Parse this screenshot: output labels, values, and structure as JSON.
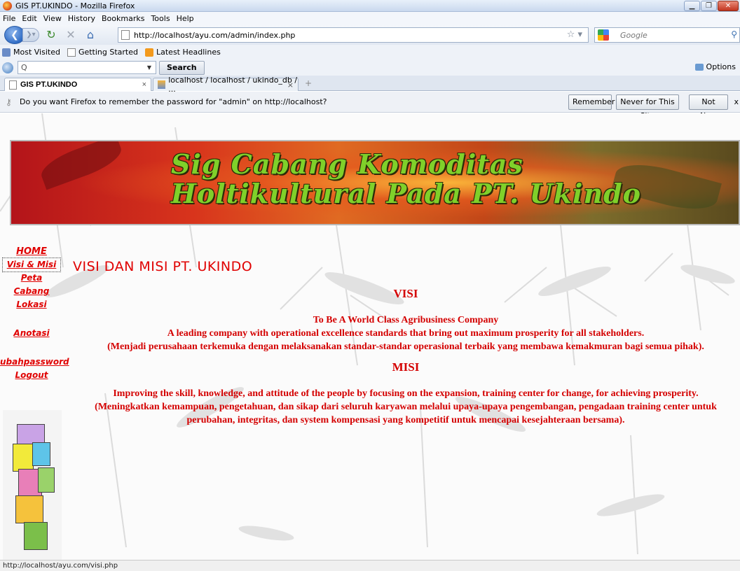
{
  "window": {
    "title": "GIS PT.UKINDO - Mozilla Firefox"
  },
  "menu": [
    "File",
    "Edit",
    "View",
    "History",
    "Bookmarks",
    "Tools",
    "Help"
  ],
  "nav": {
    "url": "http://localhost/ayu.com/admin/index.php",
    "search_engine": "Google"
  },
  "bookmarks": [
    "Most Visited",
    "Getting Started",
    "Latest Headlines"
  ],
  "search_toolbar": {
    "input_value": "Q",
    "button_label": "Search",
    "options_label": "Options"
  },
  "tabs": [
    {
      "label": "GIS PT.UKINDO",
      "close": "×"
    },
    {
      "label": "localhost / localhost / ukindo_db / ...",
      "close": "×"
    }
  ],
  "notification": {
    "message": "Do you want Firefox to remember the password for \"admin\" on http://localhost?",
    "remember": "Remember",
    "never": "Never for This Site",
    "not_now": "Not Now",
    "close": "x"
  },
  "banner": {
    "line1": "Sig Cabang Komoditas",
    "line2": "Holtikultural Pada PT. Ukindo"
  },
  "sidebar": {
    "links": [
      "HOME",
      "Visi & Misi",
      "Peta",
      "Cabang",
      "Lokasi",
      "Anotasi",
      "ubahpassword",
      "Logout"
    ]
  },
  "content": {
    "heading": "VISI DAN MISI PT. UKINDO",
    "visi_title": "VISI",
    "visi_line1": "To Be A World Class Agribusiness Company",
    "visi_line2": "A leading company with operational excellence standards that bring out maximum prosperity for all stakeholders.",
    "visi_line3": "(Menjadi perusahaan terkemuka dengan melaksanakan standar-standar operasional terbaik yang membawa kemakmuran bagi semua pihak).",
    "misi_title": "MISI",
    "misi_line1": "Improving the skill, knowledge, and attitude of the people by focusing on the expansion, training center for change, for achieving prosperity.",
    "misi_line2": "(Meningkatkan kemampuan, pengetahuan, dan sikap dari seluruh karyawan melalui upaya-upaya pengembangan, pengadaan training center untuk perubahan, integritas, dan system kompensasi yang kompetitif untuk mencapai kesejahteraan bersama)."
  },
  "status": {
    "text": "http://localhost/ayu.com/visi.php"
  },
  "colors": {
    "link_red": "#e00000",
    "content_red": "#d40000"
  }
}
